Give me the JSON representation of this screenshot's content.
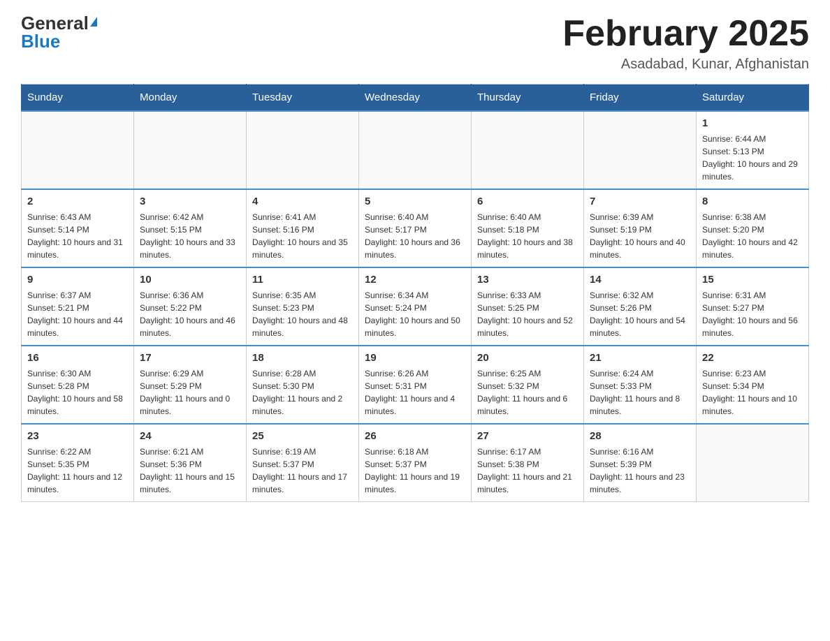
{
  "header": {
    "logo_general": "General",
    "logo_blue": "Blue",
    "title": "February 2025",
    "location": "Asadabad, Kunar, Afghanistan"
  },
  "days_of_week": [
    "Sunday",
    "Monday",
    "Tuesday",
    "Wednesday",
    "Thursday",
    "Friday",
    "Saturday"
  ],
  "weeks": [
    [
      {
        "day": "",
        "sunrise": "",
        "sunset": "",
        "daylight": "",
        "empty": true
      },
      {
        "day": "",
        "sunrise": "",
        "sunset": "",
        "daylight": "",
        "empty": true
      },
      {
        "day": "",
        "sunrise": "",
        "sunset": "",
        "daylight": "",
        "empty": true
      },
      {
        "day": "",
        "sunrise": "",
        "sunset": "",
        "daylight": "",
        "empty": true
      },
      {
        "day": "",
        "sunrise": "",
        "sunset": "",
        "daylight": "",
        "empty": true
      },
      {
        "day": "",
        "sunrise": "",
        "sunset": "",
        "daylight": "",
        "empty": true
      },
      {
        "day": "1",
        "sunrise": "Sunrise: 6:44 AM",
        "sunset": "Sunset: 5:13 PM",
        "daylight": "Daylight: 10 hours and 29 minutes.",
        "empty": false
      }
    ],
    [
      {
        "day": "2",
        "sunrise": "Sunrise: 6:43 AM",
        "sunset": "Sunset: 5:14 PM",
        "daylight": "Daylight: 10 hours and 31 minutes.",
        "empty": false
      },
      {
        "day": "3",
        "sunrise": "Sunrise: 6:42 AM",
        "sunset": "Sunset: 5:15 PM",
        "daylight": "Daylight: 10 hours and 33 minutes.",
        "empty": false
      },
      {
        "day": "4",
        "sunrise": "Sunrise: 6:41 AM",
        "sunset": "Sunset: 5:16 PM",
        "daylight": "Daylight: 10 hours and 35 minutes.",
        "empty": false
      },
      {
        "day": "5",
        "sunrise": "Sunrise: 6:40 AM",
        "sunset": "Sunset: 5:17 PM",
        "daylight": "Daylight: 10 hours and 36 minutes.",
        "empty": false
      },
      {
        "day": "6",
        "sunrise": "Sunrise: 6:40 AM",
        "sunset": "Sunset: 5:18 PM",
        "daylight": "Daylight: 10 hours and 38 minutes.",
        "empty": false
      },
      {
        "day": "7",
        "sunrise": "Sunrise: 6:39 AM",
        "sunset": "Sunset: 5:19 PM",
        "daylight": "Daylight: 10 hours and 40 minutes.",
        "empty": false
      },
      {
        "day": "8",
        "sunrise": "Sunrise: 6:38 AM",
        "sunset": "Sunset: 5:20 PM",
        "daylight": "Daylight: 10 hours and 42 minutes.",
        "empty": false
      }
    ],
    [
      {
        "day": "9",
        "sunrise": "Sunrise: 6:37 AM",
        "sunset": "Sunset: 5:21 PM",
        "daylight": "Daylight: 10 hours and 44 minutes.",
        "empty": false
      },
      {
        "day": "10",
        "sunrise": "Sunrise: 6:36 AM",
        "sunset": "Sunset: 5:22 PM",
        "daylight": "Daylight: 10 hours and 46 minutes.",
        "empty": false
      },
      {
        "day": "11",
        "sunrise": "Sunrise: 6:35 AM",
        "sunset": "Sunset: 5:23 PM",
        "daylight": "Daylight: 10 hours and 48 minutes.",
        "empty": false
      },
      {
        "day": "12",
        "sunrise": "Sunrise: 6:34 AM",
        "sunset": "Sunset: 5:24 PM",
        "daylight": "Daylight: 10 hours and 50 minutes.",
        "empty": false
      },
      {
        "day": "13",
        "sunrise": "Sunrise: 6:33 AM",
        "sunset": "Sunset: 5:25 PM",
        "daylight": "Daylight: 10 hours and 52 minutes.",
        "empty": false
      },
      {
        "day": "14",
        "sunrise": "Sunrise: 6:32 AM",
        "sunset": "Sunset: 5:26 PM",
        "daylight": "Daylight: 10 hours and 54 minutes.",
        "empty": false
      },
      {
        "day": "15",
        "sunrise": "Sunrise: 6:31 AM",
        "sunset": "Sunset: 5:27 PM",
        "daylight": "Daylight: 10 hours and 56 minutes.",
        "empty": false
      }
    ],
    [
      {
        "day": "16",
        "sunrise": "Sunrise: 6:30 AM",
        "sunset": "Sunset: 5:28 PM",
        "daylight": "Daylight: 10 hours and 58 minutes.",
        "empty": false
      },
      {
        "day": "17",
        "sunrise": "Sunrise: 6:29 AM",
        "sunset": "Sunset: 5:29 PM",
        "daylight": "Daylight: 11 hours and 0 minutes.",
        "empty": false
      },
      {
        "day": "18",
        "sunrise": "Sunrise: 6:28 AM",
        "sunset": "Sunset: 5:30 PM",
        "daylight": "Daylight: 11 hours and 2 minutes.",
        "empty": false
      },
      {
        "day": "19",
        "sunrise": "Sunrise: 6:26 AM",
        "sunset": "Sunset: 5:31 PM",
        "daylight": "Daylight: 11 hours and 4 minutes.",
        "empty": false
      },
      {
        "day": "20",
        "sunrise": "Sunrise: 6:25 AM",
        "sunset": "Sunset: 5:32 PM",
        "daylight": "Daylight: 11 hours and 6 minutes.",
        "empty": false
      },
      {
        "day": "21",
        "sunrise": "Sunrise: 6:24 AM",
        "sunset": "Sunset: 5:33 PM",
        "daylight": "Daylight: 11 hours and 8 minutes.",
        "empty": false
      },
      {
        "day": "22",
        "sunrise": "Sunrise: 6:23 AM",
        "sunset": "Sunset: 5:34 PM",
        "daylight": "Daylight: 11 hours and 10 minutes.",
        "empty": false
      }
    ],
    [
      {
        "day": "23",
        "sunrise": "Sunrise: 6:22 AM",
        "sunset": "Sunset: 5:35 PM",
        "daylight": "Daylight: 11 hours and 12 minutes.",
        "empty": false
      },
      {
        "day": "24",
        "sunrise": "Sunrise: 6:21 AM",
        "sunset": "Sunset: 5:36 PM",
        "daylight": "Daylight: 11 hours and 15 minutes.",
        "empty": false
      },
      {
        "day": "25",
        "sunrise": "Sunrise: 6:19 AM",
        "sunset": "Sunset: 5:37 PM",
        "daylight": "Daylight: 11 hours and 17 minutes.",
        "empty": false
      },
      {
        "day": "26",
        "sunrise": "Sunrise: 6:18 AM",
        "sunset": "Sunset: 5:37 PM",
        "daylight": "Daylight: 11 hours and 19 minutes.",
        "empty": false
      },
      {
        "day": "27",
        "sunrise": "Sunrise: 6:17 AM",
        "sunset": "Sunset: 5:38 PM",
        "daylight": "Daylight: 11 hours and 21 minutes.",
        "empty": false
      },
      {
        "day": "28",
        "sunrise": "Sunrise: 6:16 AM",
        "sunset": "Sunset: 5:39 PM",
        "daylight": "Daylight: 11 hours and 23 minutes.",
        "empty": false
      },
      {
        "day": "",
        "sunrise": "",
        "sunset": "",
        "daylight": "",
        "empty": true
      }
    ]
  ]
}
